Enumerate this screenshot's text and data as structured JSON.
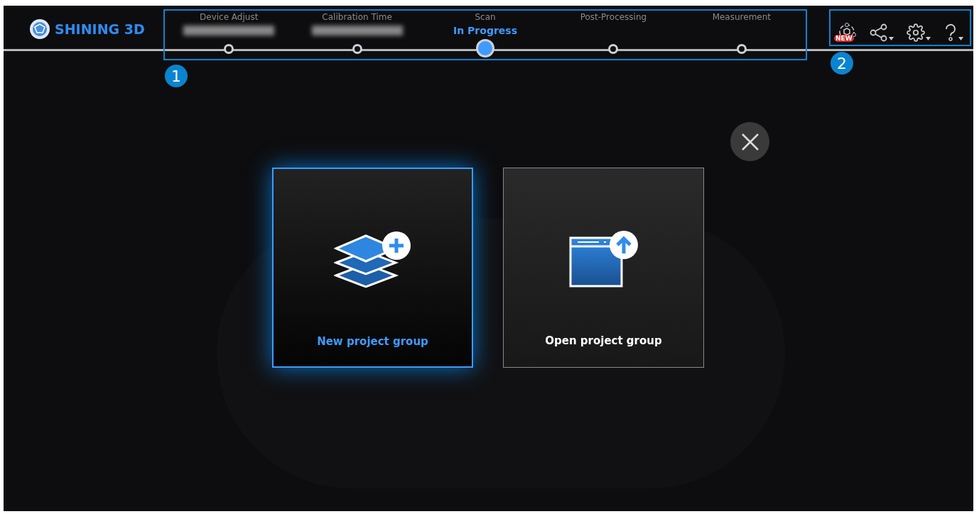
{
  "logo": {
    "text": "SHINING 3D"
  },
  "steps": [
    {
      "label": "Device Adjust",
      "redacted": true,
      "selected": false
    },
    {
      "label": "Calibration Time",
      "redacted": true,
      "selected": false
    },
    {
      "label": "Scan",
      "redacted": false,
      "selected": true,
      "status": "In Progress"
    },
    {
      "label": "Post-Processing",
      "redacted": false,
      "selected": false
    },
    {
      "label": "Measurement",
      "redacted": false,
      "selected": false
    }
  ],
  "toolbar": {
    "badge": "NEW"
  },
  "callouts": [
    "1",
    "2"
  ],
  "cards": [
    {
      "kind": "new",
      "label": "New project group",
      "selected": true
    },
    {
      "kind": "open",
      "label": "Open project group",
      "selected": false
    }
  ]
}
